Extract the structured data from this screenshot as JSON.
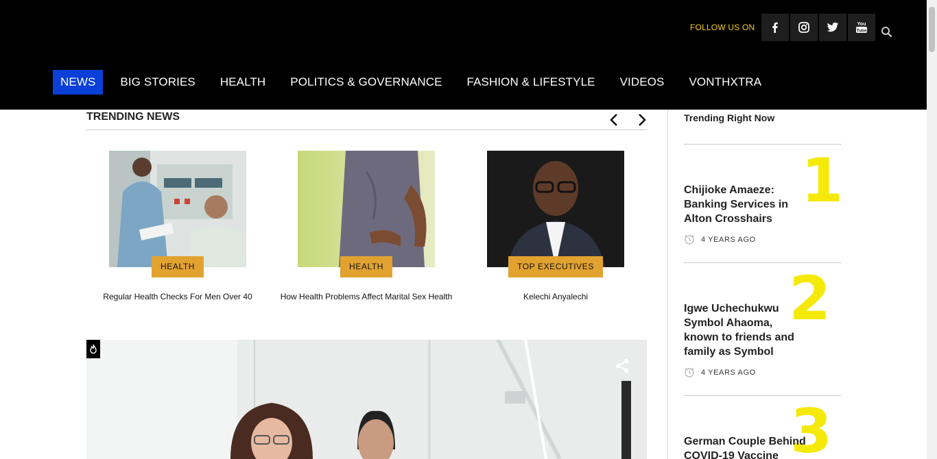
{
  "header": {
    "follow_label": "FOLLOW US ON",
    "social": [
      "facebook-icon",
      "instagram-icon",
      "twitter-icon",
      "youtube-icon"
    ]
  },
  "nav": {
    "items": [
      "NEWS",
      "BIG STORIES",
      "HEALTH",
      "POLITICS & GOVERNANCE",
      "FASHION & LIFESTYLE",
      "VIDEOS",
      "VONTHXTRA"
    ],
    "active": "NEWS"
  },
  "trending": {
    "title": "TRENDING NEWS",
    "cards": [
      {
        "category": "HEALTH",
        "caption": "Regular Health Checks For Men Over 40"
      },
      {
        "category": "HEALTH",
        "caption": "How Health Problems Affect Marital Sex Health"
      },
      {
        "category": "TOP EXECUTIVES",
        "caption": "Kelechi Anyalechi"
      }
    ]
  },
  "sidebar": {
    "title": "Trending Right Now",
    "items": [
      {
        "rank": "1",
        "headline": "Chijioke Amaeze: Banking Services in Alton Crosshairs",
        "time": "4 YEARS AGO"
      },
      {
        "rank": "2",
        "headline": "Igwe Uchechukwu Symbol Ahaoma, known to friends and family as Symbol",
        "time": "4 YEARS AGO"
      },
      {
        "rank": "3",
        "headline": "German Couple Behind COVID-19 Vaccine",
        "time": ""
      }
    ]
  },
  "colors": {
    "header_bg": "#000000",
    "nav_active": "#0a3fd8",
    "follow_text": "#f5d20a",
    "badge": "#e2a230",
    "rank_number": "#f5e90a"
  }
}
